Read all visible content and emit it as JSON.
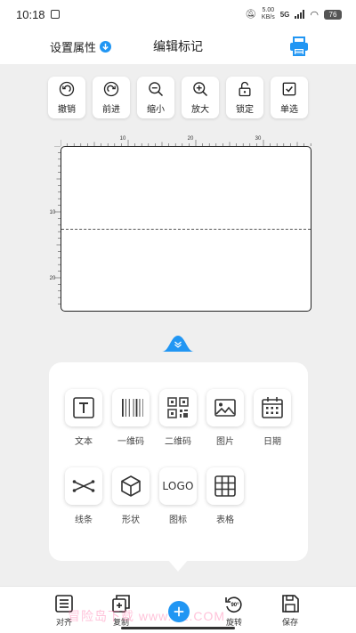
{
  "status_bar": {
    "time": "10:18",
    "network_speed": "5.00\nKB/s",
    "network_type": "5G",
    "battery": "76"
  },
  "header": {
    "settings_label": "设置属性",
    "title": "编辑标记"
  },
  "toolbar": [
    {
      "label": "撤销",
      "icon": "undo-icon"
    },
    {
      "label": "前进",
      "icon": "redo-icon"
    },
    {
      "label": "缩小",
      "icon": "zoom-out-icon"
    },
    {
      "label": "放大",
      "icon": "zoom-in-icon"
    },
    {
      "label": "锁定",
      "icon": "lock-icon"
    },
    {
      "label": "单选",
      "icon": "checkbox-icon"
    }
  ],
  "ruler": {
    "top_ticks": [
      "10",
      "20",
      "30"
    ],
    "left_ticks": [
      "10",
      "20"
    ]
  },
  "elements_panel": [
    {
      "label": "文本",
      "icon": "text-icon"
    },
    {
      "label": "一维码",
      "icon": "barcode-icon"
    },
    {
      "label": "二维码",
      "icon": "qrcode-icon"
    },
    {
      "label": "图片",
      "icon": "image-icon"
    },
    {
      "label": "日期",
      "icon": "calendar-icon"
    },
    {
      "label": "线条",
      "icon": "line-icon"
    },
    {
      "label": "形状",
      "icon": "cube-icon"
    },
    {
      "label": "图标",
      "icon": "logo-icon",
      "icon_text": "LOGO"
    },
    {
      "label": "表格",
      "icon": "table-icon"
    }
  ],
  "bottom_bar": [
    {
      "label": "对齐",
      "icon": "align-icon"
    },
    {
      "label": "复制",
      "icon": "copy-icon"
    },
    {
      "label": "旋转",
      "icon": "rotate-icon",
      "icon_text": "90°"
    },
    {
      "label": "保存",
      "icon": "save-icon"
    }
  ],
  "watermark": "冒险岛下载 www.KL.COM",
  "colors": {
    "accent": "#2196f3",
    "background": "#efefef"
  }
}
